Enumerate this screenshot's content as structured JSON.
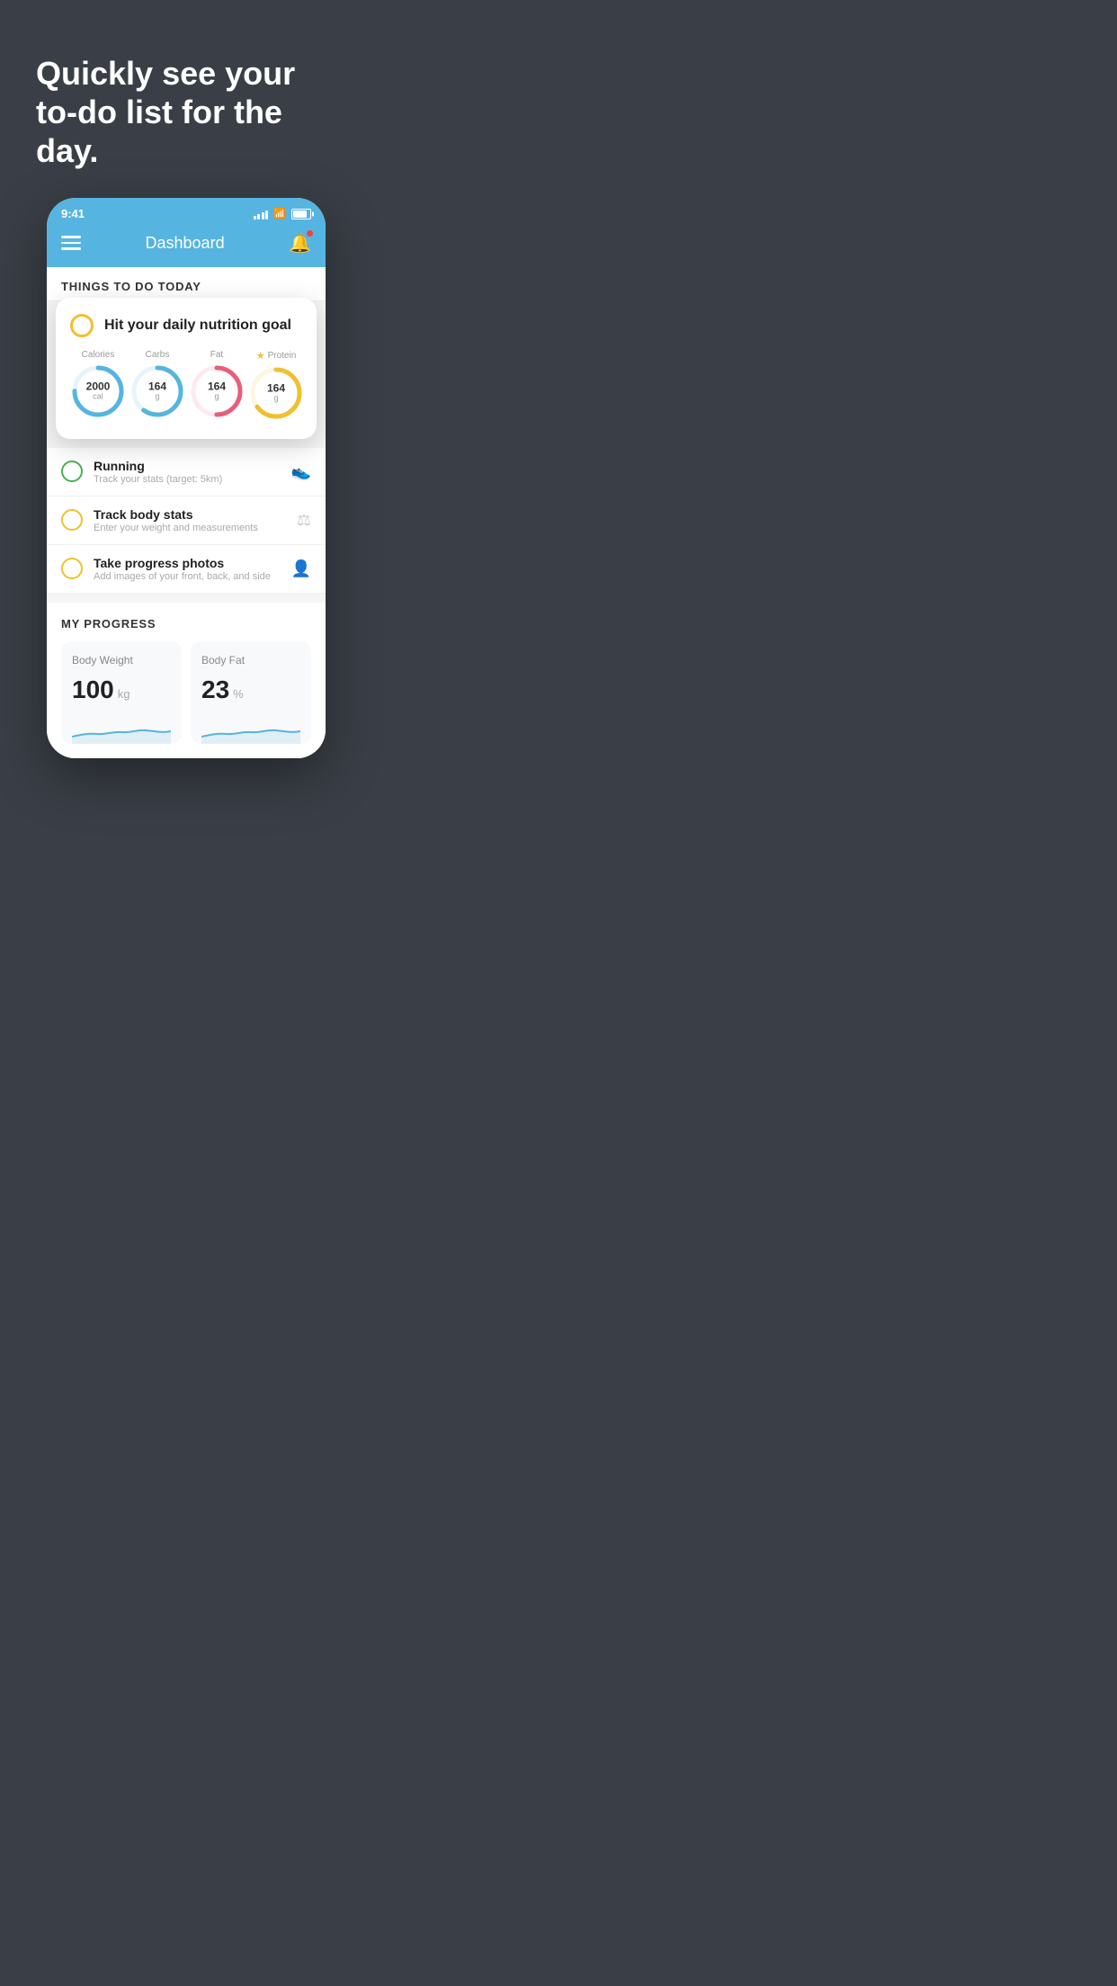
{
  "hero": {
    "title": "Quickly see your to-do list for the day."
  },
  "phone": {
    "statusBar": {
      "time": "9:41"
    },
    "header": {
      "title": "Dashboard",
      "menuLabel": "menu",
      "bellLabel": "notifications"
    },
    "todaySection": {
      "heading": "THINGS TO DO TODAY"
    },
    "floatingCard": {
      "title": "Hit your daily nutrition goal",
      "nutrition": [
        {
          "label": "Calories",
          "value": "2000",
          "unit": "cal",
          "color": "#56b4e0",
          "trackColor": "#e8f4fb",
          "progress": 75,
          "starred": false
        },
        {
          "label": "Carbs",
          "value": "164",
          "unit": "g",
          "color": "#56b4e0",
          "trackColor": "#e8f4fb",
          "progress": 60,
          "starred": false
        },
        {
          "label": "Fat",
          "value": "164",
          "unit": "g",
          "color": "#e85e7a",
          "trackColor": "#fdeaf0",
          "progress": 50,
          "starred": false
        },
        {
          "label": "Protein",
          "value": "164",
          "unit": "g",
          "color": "#f0c030",
          "trackColor": "#fdf6e0",
          "progress": 65,
          "starred": true
        }
      ]
    },
    "todoItems": [
      {
        "title": "Running",
        "subtitle": "Track your stats (target: 5km)",
        "checkType": "green",
        "iconType": "shoe"
      },
      {
        "title": "Track body stats",
        "subtitle": "Enter your weight and measurements",
        "checkType": "yellow",
        "iconType": "scale"
      },
      {
        "title": "Take progress photos",
        "subtitle": "Add images of your front, back, and side",
        "checkType": "yellow",
        "iconType": "person"
      }
    ],
    "progressSection": {
      "heading": "MY PROGRESS",
      "cards": [
        {
          "title": "Body Weight",
          "value": "100",
          "unit": "kg"
        },
        {
          "title": "Body Fat",
          "value": "23",
          "unit": "%"
        }
      ]
    }
  }
}
